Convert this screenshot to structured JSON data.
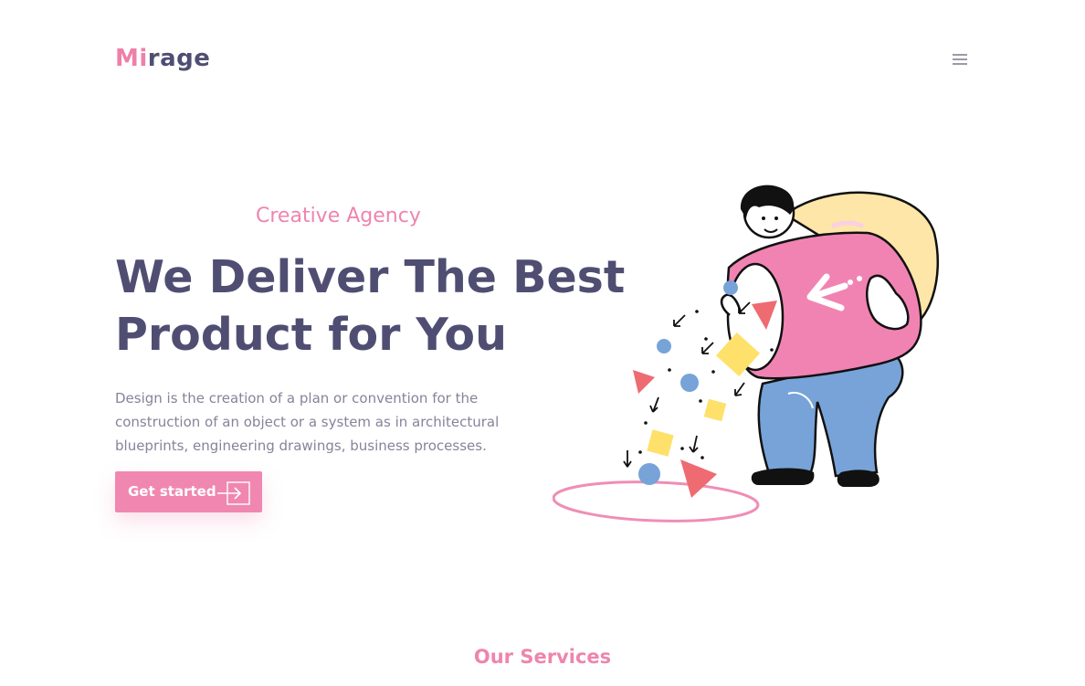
{
  "brand": {
    "logo_accent": "Mi",
    "logo_rest": "rage",
    "accent_color": "#ef7fa8",
    "text_color": "#4f4e72"
  },
  "nav": {
    "menu_icon": "hamburger-menu-icon"
  },
  "hero": {
    "eyebrow": "Creative Agency",
    "title_line1": "We Deliver The Best",
    "title_line2": "Product for You",
    "description_lines": [
      "Design is the creation of a plan or convention for the",
      "construction of an object or a system as in architectural",
      "blueprints, engineering drawings, business processes."
    ],
    "cta_label": "Get started",
    "cta_icon": "arrow-into-box-icon"
  },
  "illustration": {
    "icon": "person-pouring-shapes-illustration"
  },
  "services": {
    "title": "Our Services"
  }
}
